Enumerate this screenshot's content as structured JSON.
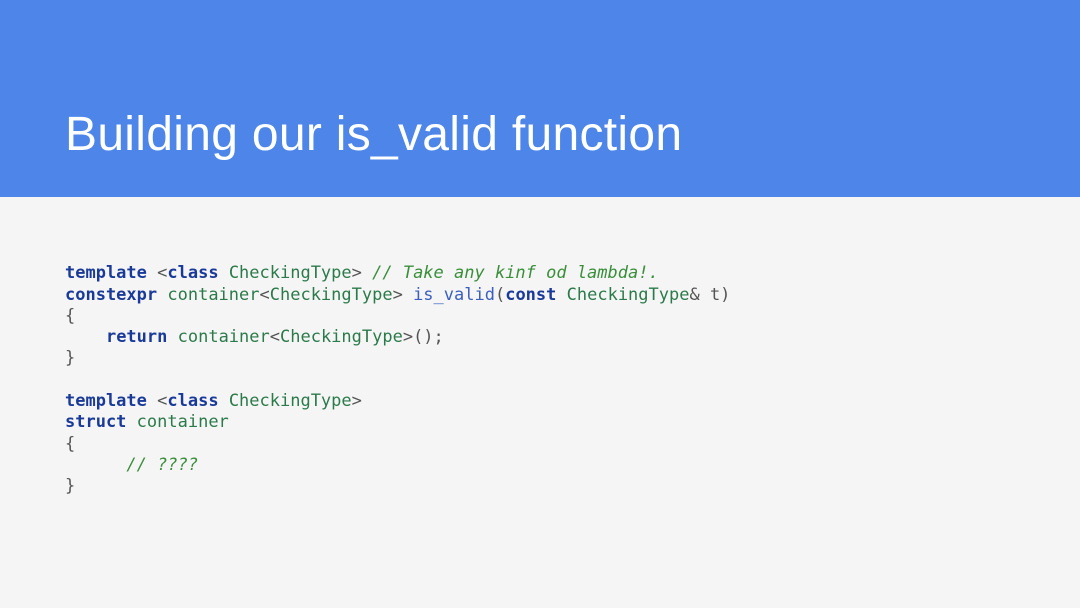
{
  "slide": {
    "title": "Building our is_valid function"
  },
  "code": {
    "line1": {
      "kw_template": "template",
      "lt": " <",
      "kw_class": "class",
      "sp1": " ",
      "type": "CheckingType",
      "gt": "> ",
      "comment": "// Take any kinf od lambda!."
    },
    "line2": {
      "kw_constexpr": "constexpr",
      "sp1": " ",
      "container": "container",
      "lt": "<",
      "type1": "CheckingType",
      "gt": "> ",
      "fn": "is_valid",
      "lparen": "(",
      "kw_const": "const",
      "sp2": " ",
      "type2": "CheckingType",
      "amp_t": "& t)"
    },
    "line3": {
      "brace": "{"
    },
    "line4": {
      "indent": "    ",
      "kw_return": "return",
      "sp1": " ",
      "container": "container",
      "lt": "<",
      "type": "CheckingType",
      "gt": ">();"
    },
    "line5": {
      "brace": "}"
    },
    "line6": {
      "blank": ""
    },
    "line7": {
      "kw_template": "template",
      "lt": " <",
      "kw_class": "class",
      "sp1": " ",
      "type": "CheckingType",
      "gt": ">"
    },
    "line8": {
      "kw_struct": "struct",
      "sp1": " ",
      "container": "container"
    },
    "line9": {
      "brace": "{"
    },
    "line10": {
      "indent": "      ",
      "comment": "// ????"
    },
    "line11": {
      "brace": "}"
    }
  }
}
